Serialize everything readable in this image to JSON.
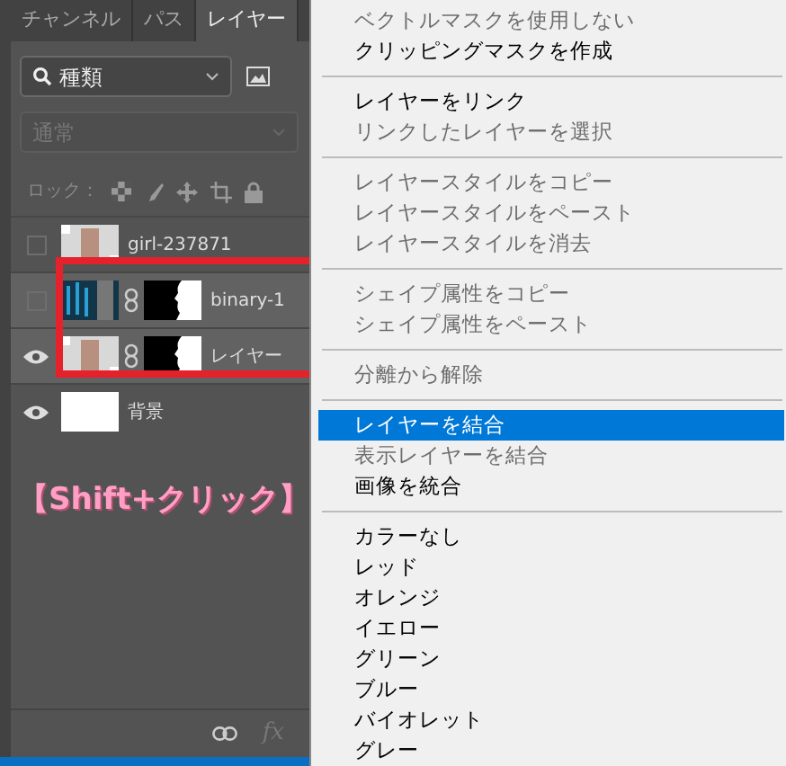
{
  "panel": {
    "tabs": [
      {
        "label": "チャンネル",
        "selected": false
      },
      {
        "label": "パス",
        "selected": false
      },
      {
        "label": "レイヤー",
        "selected": true
      }
    ],
    "filter": {
      "value": "種類"
    },
    "blend_mode": {
      "value": "通常",
      "disabled": true
    },
    "lock": {
      "label": "ロック："
    },
    "layers": [
      {
        "name": "girl-237871",
        "visible": false,
        "selected": false,
        "kind": "photo",
        "mask": false
      },
      {
        "name": "binary-1",
        "visible": false,
        "selected": true,
        "kind": "binary",
        "mask": true
      },
      {
        "name": "レイヤー",
        "visible": true,
        "selected": true,
        "kind": "photo",
        "mask": true
      },
      {
        "name": "背景",
        "visible": true,
        "selected": false,
        "kind": "white",
        "mask": false
      }
    ],
    "annotation": "【Shift+クリック】",
    "footer": {
      "fx_label": "fx"
    }
  },
  "menu": {
    "sections": [
      [
        {
          "label": "ベクトルマスクを使用しない",
          "disabled": true,
          "selected": false
        },
        {
          "label": "クリッピングマスクを作成",
          "disabled": false,
          "selected": false
        }
      ],
      [
        {
          "label": "レイヤーをリンク",
          "disabled": false,
          "selected": false
        },
        {
          "label": "リンクしたレイヤーを選択",
          "disabled": true,
          "selected": false
        }
      ],
      [
        {
          "label": "レイヤースタイルをコピー",
          "disabled": true,
          "selected": false
        },
        {
          "label": "レイヤースタイルをペースト",
          "disabled": true,
          "selected": false
        },
        {
          "label": "レイヤースタイルを消去",
          "disabled": true,
          "selected": false
        }
      ],
      [
        {
          "label": "シェイプ属性をコピー",
          "disabled": true,
          "selected": false
        },
        {
          "label": "シェイプ属性をペースト",
          "disabled": true,
          "selected": false
        }
      ],
      [
        {
          "label": "分離から解除",
          "disabled": true,
          "selected": false
        }
      ],
      [
        {
          "label": "レイヤーを結合",
          "disabled": false,
          "selected": true
        },
        {
          "label": "表示レイヤーを結合",
          "disabled": true,
          "selected": false
        },
        {
          "label": "画像を統合",
          "disabled": false,
          "selected": false
        }
      ],
      [
        {
          "label": "カラーなし",
          "disabled": false,
          "selected": false
        },
        {
          "label": "レッド",
          "disabled": false,
          "selected": false
        },
        {
          "label": "オレンジ",
          "disabled": false,
          "selected": false
        },
        {
          "label": "イエロー",
          "disabled": false,
          "selected": false
        },
        {
          "label": "グリーン",
          "disabled": false,
          "selected": false
        },
        {
          "label": "ブルー",
          "disabled": false,
          "selected": false
        },
        {
          "label": "バイオレット",
          "disabled": false,
          "selected": false
        },
        {
          "label": "グレー",
          "disabled": false,
          "selected": false
        }
      ]
    ]
  }
}
